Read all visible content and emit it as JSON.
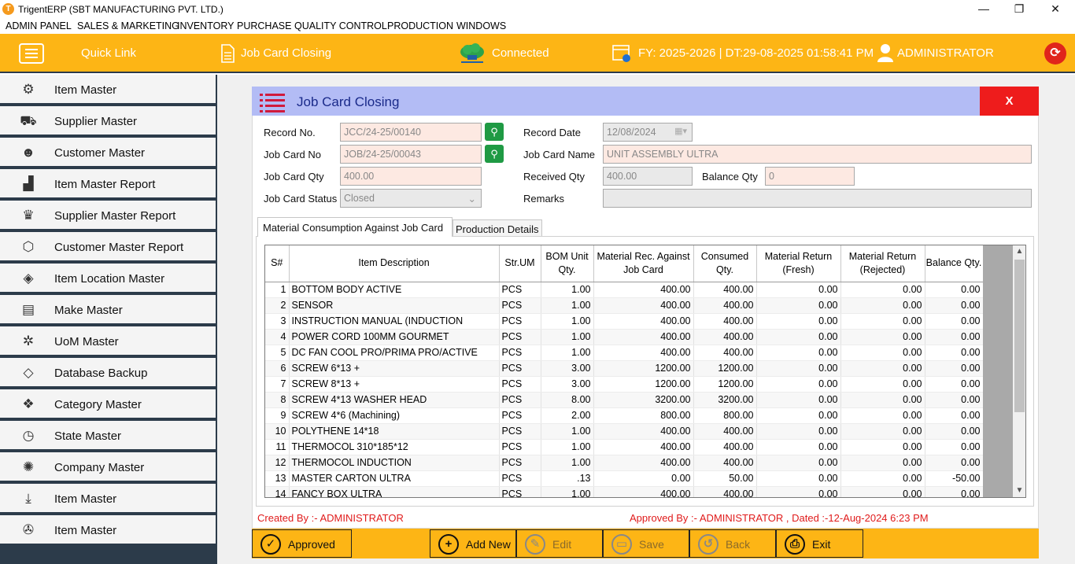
{
  "window": {
    "title": "TrigentERP (SBT MANUFACTURING PVT. LTD.)",
    "minimize": "—",
    "maximize": "❐",
    "close": "✕"
  },
  "menu": [
    "ADMIN PANEL",
    "SALES & MARKETING",
    "INVENTORY",
    "PURCHASE",
    "QUALITY CONTROL",
    "PRODUCTION",
    "WINDOWS"
  ],
  "toolbar": {
    "quick_link": "Quick Link",
    "module": "Job Card Closing",
    "status": "Connected",
    "fy_info": "FY: 2025-2026 | DT:29-08-2025 01:58:41 PM",
    "user": "ADMINISTRATOR"
  },
  "sidebar": {
    "items": [
      {
        "label": "Item Master",
        "icon": "gears-icon",
        "glyph": "⚙"
      },
      {
        "label": "Supplier Master",
        "icon": "supplier-icon",
        "glyph": "⛟"
      },
      {
        "label": "Customer Master",
        "icon": "customer-icon",
        "glyph": "☻"
      },
      {
        "label": "Item Master Report",
        "icon": "chart-icon",
        "glyph": "▟"
      },
      {
        "label": "Supplier Master Report",
        "icon": "supplier-report-icon",
        "glyph": "♛"
      },
      {
        "label": "Customer Master Report",
        "icon": "boxes-icon",
        "glyph": "⬡"
      },
      {
        "label": "Item Location Master",
        "icon": "layers-icon",
        "glyph": "◈"
      },
      {
        "label": "Make Master",
        "icon": "make-icon",
        "glyph": "▤"
      },
      {
        "label": "UoM Master",
        "icon": "uom-icon",
        "glyph": "✲"
      },
      {
        "label": "Database Backup",
        "icon": "tag-icon",
        "glyph": "◇"
      },
      {
        "label": "Category Master",
        "icon": "category-icon",
        "glyph": "❖"
      },
      {
        "label": "State Master",
        "icon": "history-icon",
        "glyph": "◷"
      },
      {
        "label": "Company Master",
        "icon": "company-icon",
        "glyph": "✺"
      },
      {
        "label": "Item Master",
        "icon": "download-tray-icon",
        "glyph": "⤓"
      },
      {
        "label": "Item Master",
        "icon": "network-icon",
        "glyph": "✇"
      }
    ]
  },
  "form": {
    "title": "Job Card Closing",
    "close_label": "X",
    "record_no_label": "Record No.",
    "record_no": "JCC/24-25/00140",
    "job_card_no_label": "Job Card No",
    "job_card_no": "JOB/24-25/00043",
    "job_card_qty_label": "Job Card Qty",
    "job_card_qty": "400.00",
    "job_card_status_label": "Job Card Status",
    "job_card_status": "Closed",
    "record_date_label": "Record Date",
    "record_date": "12/08/2024",
    "job_card_name_label": "Job Card Name",
    "job_card_name": "UNIT ASSEMBLY ULTRA",
    "received_qty_label": "Received Qty",
    "received_qty": "400.00",
    "balance_qty_label": "Balance Qty",
    "balance_qty": "0",
    "remarks_label": "Remarks",
    "remarks": ""
  },
  "tabs": [
    "Material Consumption Against Job Card",
    "Production Details"
  ],
  "grid": {
    "headers": [
      "S#",
      "Item Description",
      "Str.UM",
      "BOM Unit Qty.",
      "Material Rec. Against Job Card",
      "Consumed Qty.",
      "Material Return (Fresh)",
      "Material Return (Rejected)",
      "Balance Qty."
    ],
    "rows": [
      [
        "1",
        "BOTTOM BODY ACTIVE",
        "PCS",
        "1.00",
        "400.00",
        "400.00",
        "0.00",
        "0.00",
        "0.00"
      ],
      [
        "2",
        "SENSOR",
        "PCS",
        "1.00",
        "400.00",
        "400.00",
        "0.00",
        "0.00",
        "0.00"
      ],
      [
        "3",
        "INSTRUCTION MANUAL (INDUCTION",
        "PCS",
        "1.00",
        "400.00",
        "400.00",
        "0.00",
        "0.00",
        "0.00"
      ],
      [
        "4",
        "POWER CORD 100MM GOURMET",
        "PCS",
        "1.00",
        "400.00",
        "400.00",
        "0.00",
        "0.00",
        "0.00"
      ],
      [
        "5",
        "DC FAN COOL PRO/PRIMA PRO/ACTIVE",
        "PCS",
        "1.00",
        "400.00",
        "400.00",
        "0.00",
        "0.00",
        "0.00"
      ],
      [
        "6",
        "SCREW 6*13 +",
        "PCS",
        "3.00",
        "1200.00",
        "1200.00",
        "0.00",
        "0.00",
        "0.00"
      ],
      [
        "7",
        "SCREW 8*13 +",
        "PCS",
        "3.00",
        "1200.00",
        "1200.00",
        "0.00",
        "0.00",
        "0.00"
      ],
      [
        "8",
        "SCREW 4*13 WASHER HEAD",
        "PCS",
        "8.00",
        "3200.00",
        "3200.00",
        "0.00",
        "0.00",
        "0.00"
      ],
      [
        "9",
        "SCREW 4*6 (Machining)",
        "PCS",
        "2.00",
        "800.00",
        "800.00",
        "0.00",
        "0.00",
        "0.00"
      ],
      [
        "10",
        "POLYTHENE 14*18",
        "PCS",
        "1.00",
        "400.00",
        "400.00",
        "0.00",
        "0.00",
        "0.00"
      ],
      [
        "11",
        "THERMOCOL 310*185*12",
        "PCS",
        "1.00",
        "400.00",
        "400.00",
        "0.00",
        "0.00",
        "0.00"
      ],
      [
        "12",
        "THERMOCOL INDUCTION",
        "PCS",
        "1.00",
        "400.00",
        "400.00",
        "0.00",
        "0.00",
        "0.00"
      ],
      [
        "13",
        "MASTER CARTON ULTRA",
        "PCS",
        ".13",
        "0.00",
        "50.00",
        "0.00",
        "0.00",
        "-50.00"
      ],
      [
        "14",
        "FANCY BOX ULTRA",
        "PCS",
        "1.00",
        "400.00",
        "400.00",
        "0.00",
        "0.00",
        "0.00"
      ]
    ]
  },
  "footer": {
    "created_by": "Created By :- ADMINISTRATOR",
    "approved_by": "Approved By :- ADMINISTRATOR , Dated :-12-Aug-2024 6:23 PM"
  },
  "buttons": {
    "approved": "Approved",
    "add_new": "Add New",
    "edit": "Edit",
    "save": "Save",
    "back": "Back",
    "exit": "Exit"
  },
  "colors": {
    "accent": "#fdb515",
    "sidebar": "#2c3b4a",
    "header": "#b3bcf5",
    "close": "#ee1c1c"
  }
}
